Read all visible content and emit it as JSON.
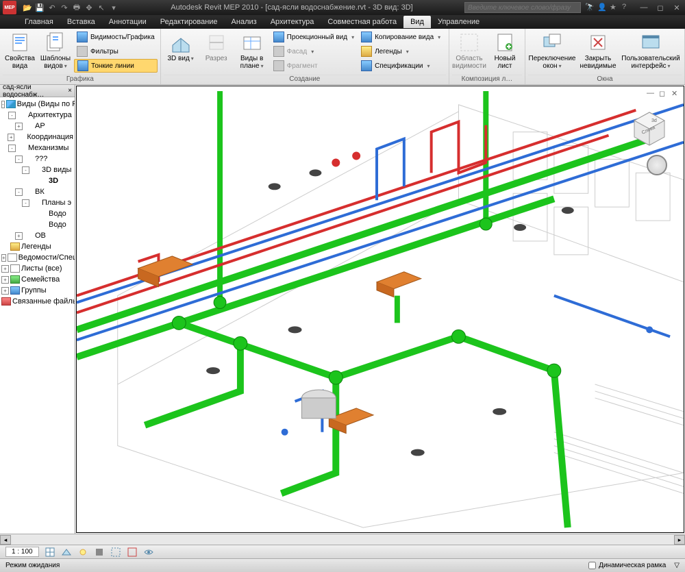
{
  "titlebar": {
    "app_label": "MEP",
    "title": "Autodesk Revit MEP 2010 - [сад-ясли водоснабжение.rvt - 3D вид: 3D]",
    "search_placeholder": "Введите ключевое слово/фразу"
  },
  "menu": {
    "tabs": [
      "Главная",
      "Вставка",
      "Аннотации",
      "Редактирование",
      "Анализ",
      "Архитектура",
      "Совместная работа",
      "Вид",
      "Управление"
    ],
    "active": "Вид"
  },
  "ribbon": {
    "groups": [
      {
        "label": "Графика",
        "big": [
          {
            "name": "view-properties",
            "label": "Свойства\nвида"
          },
          {
            "name": "view-templates",
            "label": "Шаблоны\nвидов",
            "dd": true
          }
        ],
        "small": [
          {
            "name": "visibility-graphics",
            "label": "Видимость/Графика",
            "icon": "blue"
          },
          {
            "name": "filters",
            "label": "Фильтры",
            "icon": "gray"
          },
          {
            "name": "thin-lines",
            "label": "Тонкие линии",
            "icon": "blue",
            "active": true
          }
        ]
      },
      {
        "label": "Создание",
        "big": [
          {
            "name": "3d-view",
            "label": "3D\nвид",
            "dd": true
          },
          {
            "name": "section",
            "label": "Разрез",
            "disabled": true
          },
          {
            "name": "plan-views",
            "label": "Виды\nв плане",
            "dd": true
          }
        ],
        "small": [
          {
            "name": "projection-view",
            "label": "Проекционный вид",
            "icon": "blue",
            "dd": true
          },
          {
            "name": "elevation",
            "label": "Фасад",
            "icon": "gray",
            "dd": true,
            "disabled": true
          },
          {
            "name": "fragment",
            "label": "Фрагмент",
            "icon": "gray",
            "disabled": true
          }
        ],
        "small2": [
          {
            "name": "duplicate-view",
            "label": "Копирование вида",
            "icon": "blue",
            "dd": true
          },
          {
            "name": "legends",
            "label": "Легенды",
            "icon": "yellow",
            "dd": true
          },
          {
            "name": "schedules",
            "label": "Спецификации",
            "icon": "blue",
            "dd": true
          }
        ]
      },
      {
        "label": "Композиция л…",
        "big": [
          {
            "name": "visibility-region",
            "label": "Область\nвидимости",
            "disabled": true
          },
          {
            "name": "new-sheet",
            "label": "Новый\nлист"
          }
        ]
      },
      {
        "label": "Окна",
        "big": [
          {
            "name": "switch-windows",
            "label": "Переключение\nокон",
            "dd": true
          },
          {
            "name": "close-hidden",
            "label": "Закрыть\nневидимые"
          },
          {
            "name": "user-interface",
            "label": "Пользовательский\nинтерфейс",
            "dd": true
          }
        ]
      }
    ]
  },
  "browser": {
    "title": "сад-ясли водоснабж…",
    "nodes": [
      {
        "d": 0,
        "exp": "-",
        "icon": "cube",
        "label": "Виды (Виды по Р"
      },
      {
        "d": 1,
        "exp": "-",
        "icon": "",
        "label": "Архитектура"
      },
      {
        "d": 2,
        "exp": "+",
        "icon": "",
        "label": "АР"
      },
      {
        "d": 1,
        "exp": "+",
        "icon": "",
        "label": "Координация"
      },
      {
        "d": 1,
        "exp": "-",
        "icon": "",
        "label": "Механизмы"
      },
      {
        "d": 2,
        "exp": "-",
        "icon": "",
        "label": "???"
      },
      {
        "d": 3,
        "exp": "-",
        "icon": "",
        "label": "3D виды"
      },
      {
        "d": 4,
        "exp": "",
        "icon": "",
        "label": "3D",
        "selected": true
      },
      {
        "d": 2,
        "exp": "-",
        "icon": "",
        "label": "ВК"
      },
      {
        "d": 3,
        "exp": "-",
        "icon": "",
        "label": "Планы э"
      },
      {
        "d": 4,
        "exp": "",
        "icon": "",
        "label": "Водо"
      },
      {
        "d": 4,
        "exp": "",
        "icon": "",
        "label": "Водо"
      },
      {
        "d": 2,
        "exp": "+",
        "icon": "",
        "label": "ОВ"
      },
      {
        "d": 0,
        "exp": "",
        "icon": "yellow",
        "label": "Легенды"
      },
      {
        "d": 0,
        "exp": "+",
        "icon": "sheet",
        "label": "Ведомости/Спец"
      },
      {
        "d": 0,
        "exp": "+",
        "icon": "sheet",
        "label": "Листы (все)"
      },
      {
        "d": 0,
        "exp": "+",
        "icon": "green",
        "label": "Семейства"
      },
      {
        "d": 0,
        "exp": "+",
        "icon": "blue",
        "label": "Группы"
      },
      {
        "d": 0,
        "exp": "",
        "icon": "red",
        "label": "Связанные файлы"
      }
    ]
  },
  "viewbar": {
    "scale": "1 : 100"
  },
  "statusbar": {
    "mode": "Режим ожидания",
    "dynamic_frame": "Динамическая рамка"
  },
  "colors": {
    "pipe_green": "#1cc41c",
    "pipe_blue": "#2e6cd6",
    "pipe_red": "#d62e2e",
    "fixture_orange": "#e08030",
    "building": "#bbbbbb"
  }
}
